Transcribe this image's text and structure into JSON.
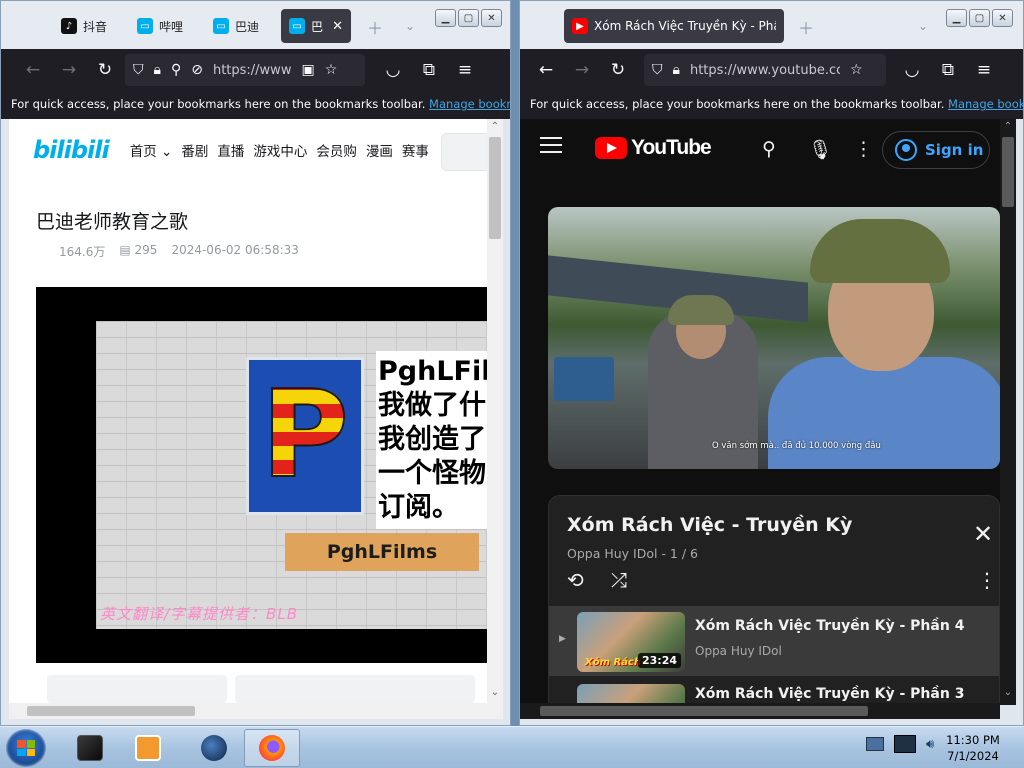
{
  "left_window": {
    "tabs": [
      {
        "label": "抖音",
        "icon": "tiktok-icon",
        "color": "#111111"
      },
      {
        "label": "哔哩",
        "icon": "bilibili-tv-icon",
        "color": "#00aeec"
      },
      {
        "label": "巴迪",
        "icon": "bilibili-tv-icon",
        "color": "#00aeec"
      },
      {
        "label": "巴",
        "icon": "bilibili-tv-icon",
        "color": "#00aeec",
        "active": true
      }
    ],
    "url": "https://www",
    "bookmarks_text": "For quick access, place your bookmarks here on the bookmarks toolbar.",
    "manage_bookmarks": "Manage bookmarks",
    "page": {
      "logo": "bilibili",
      "nav": [
        "首页",
        "番剧",
        "直播",
        "游戏中心",
        "会员购",
        "漫画",
        "赛事"
      ],
      "video_title": "巴迪老师教育之歌",
      "views": "164.6万",
      "danmaku": "295",
      "date": "2024-06-02 06:58:33",
      "frame_promo": "PghLFil\n我做了什\n我创造了\n一个怪物\n订阅。",
      "frame_sign": "PghLFilms",
      "frame_subtitle": "英文翻译/字幕提供者：BLB"
    }
  },
  "right_window": {
    "tab_title": "Xóm Rách Việc Truyền Kỳ - Phầ",
    "url": "https://www.youtube.com",
    "bookmarks_text": "For quick access, place your bookmarks here on the bookmarks toolbar.",
    "manage_bookmarks": "Manage bookmarks",
    "page": {
      "logo": "YouTube",
      "sign_in": "Sign in",
      "video_caption": "O văn sớm mà.. đã đủ 10.000 vòng đâu",
      "playlist": {
        "title": "Xóm Rách Việc - Truyền Kỳ",
        "subtitle": "Oppa Huy IDol - 1 / 6",
        "items": [
          {
            "title": "Xóm Rách Việc Truyền Kỳ - Phần 4",
            "channel": "Oppa Huy IDol",
            "duration": "23:24",
            "thumb_tag": "Xóm Rách"
          },
          {
            "title": "Xóm Rách Việc Truyền Kỳ - Phần 3",
            "channel": "",
            "duration": "",
            "thumb_tag": ""
          }
        ]
      }
    }
  },
  "taskbar": {
    "time": "11:30 PM",
    "date": "7/1/2024"
  },
  "colors": {
    "bilibili_accent": "#00aeec",
    "youtube_red": "#ff0000",
    "youtube_link": "#3ea6ff",
    "firefox_chrome": "#1f1e24"
  }
}
